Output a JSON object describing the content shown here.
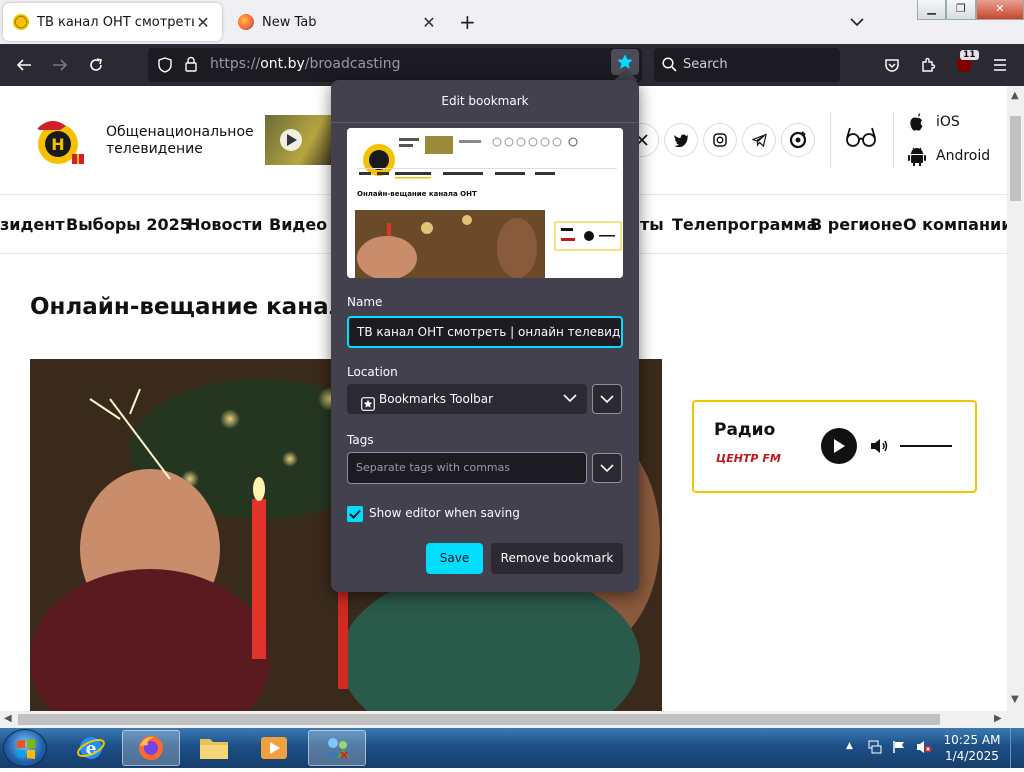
{
  "tabs": [
    {
      "title": "ТВ канал ОНТ смотреть | онлайн",
      "close": "✕"
    },
    {
      "title": "New Tab",
      "close": "✕"
    }
  ],
  "new_tab": "+",
  "nav": {
    "url_prefix": "https://",
    "url_host": "ont.by",
    "url_path": "/broadcasting",
    "search_placeholder": "Search",
    "ext_badge": "11"
  },
  "page": {
    "brand_line1": "Общенациональное",
    "brand_line2": "телевидение",
    "apps": [
      "iOS",
      "Android"
    ],
    "menu": [
      "зидент",
      "Выборы 2025",
      "Новости",
      "Видео",
      "ты",
      "Телепрограмма",
      "В регионе",
      "О компании"
    ],
    "heading": "Онлайн-вещание канала",
    "radio_title": "Радио",
    "radio_logo": "ЦЕНТР FM"
  },
  "bookmark": {
    "header": "Edit bookmark",
    "name_label": "Name",
    "name_value": "ТВ канал ОНТ смотреть | онлайн телевидение Беларусь",
    "location_label": "Location",
    "location_value": "Bookmarks Toolbar",
    "tags_label": "Tags",
    "tags_placeholder": "Separate tags with commas",
    "show_editor_label": "Show editor when saving",
    "show_editor_checked": true,
    "save_label": "Save",
    "remove_label": "Remove bookmark",
    "thumb_heading": "Онлайн-вещание канала ОНТ",
    "thumb_radio": "Радио"
  },
  "taskbar": {
    "time": "10:25 AM",
    "date": "1/4/2025"
  },
  "colors": {
    "accent": "#00ddff",
    "panel": "#42414d",
    "toolbar": "#2b2a33"
  }
}
